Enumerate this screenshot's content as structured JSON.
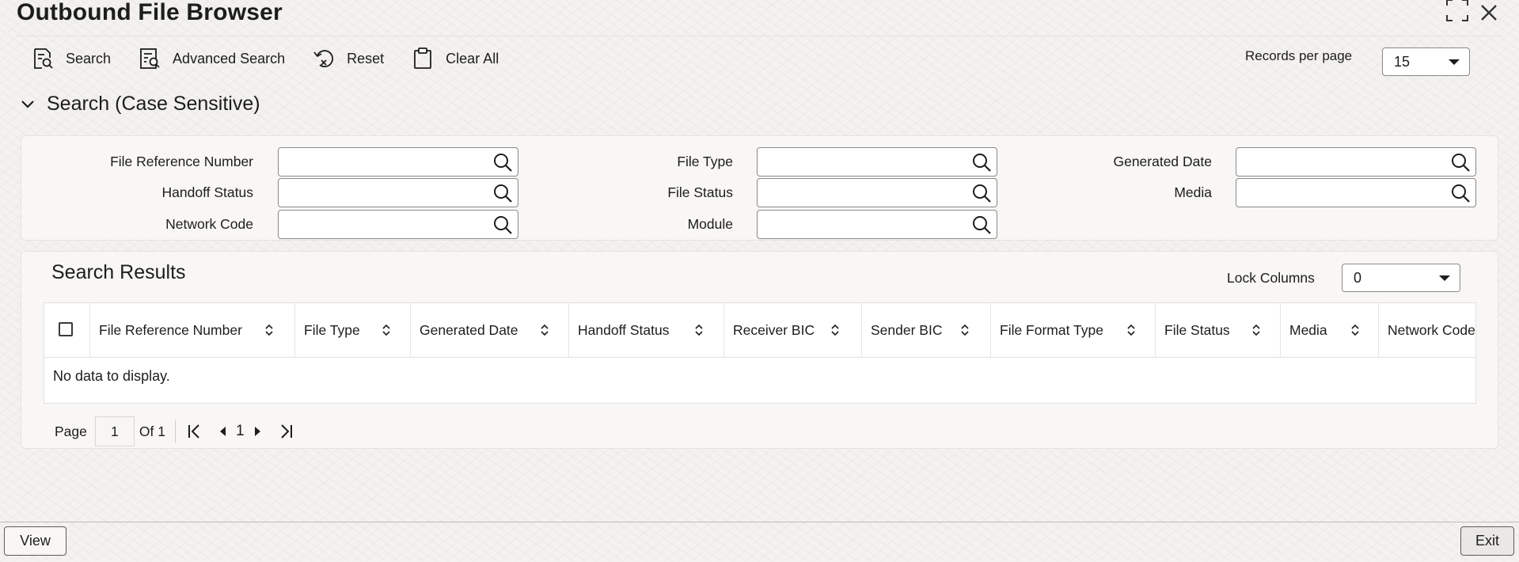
{
  "window": {
    "title": "Outbound File Browser"
  },
  "toolbar": {
    "search": "Search",
    "advanced_search": "Advanced Search",
    "reset": "Reset",
    "clear_all": "Clear All"
  },
  "records_per_page": {
    "label": "Records per page",
    "value": "15"
  },
  "search_section": {
    "title": "Search (Case Sensitive)",
    "fields": {
      "file_reference_number": {
        "label": "File Reference Number",
        "value": ""
      },
      "file_type": {
        "label": "File Type",
        "value": ""
      },
      "generated_date": {
        "label": "Generated Date",
        "value": ""
      },
      "handoff_status": {
        "label": "Handoff Status",
        "value": ""
      },
      "file_status": {
        "label": "File Status",
        "value": ""
      },
      "media": {
        "label": "Media",
        "value": ""
      },
      "network_code": {
        "label": "Network Code",
        "value": ""
      },
      "module": {
        "label": "Module",
        "value": ""
      }
    }
  },
  "results": {
    "title": "Search Results",
    "lock_columns": {
      "label": "Lock Columns",
      "value": "0"
    },
    "columns": [
      "File Reference Number",
      "File Type",
      "Generated Date",
      "Handoff Status",
      "Receiver BIC",
      "Sender BIC",
      "File Format Type",
      "File Status",
      "Media",
      "Network Code"
    ],
    "empty_message": "No data to display."
  },
  "pagination": {
    "page_label": "Page",
    "current_page": "1",
    "of_label": "Of 1",
    "nav_page": "1"
  },
  "footer": {
    "view": "View",
    "exit": "Exit"
  }
}
